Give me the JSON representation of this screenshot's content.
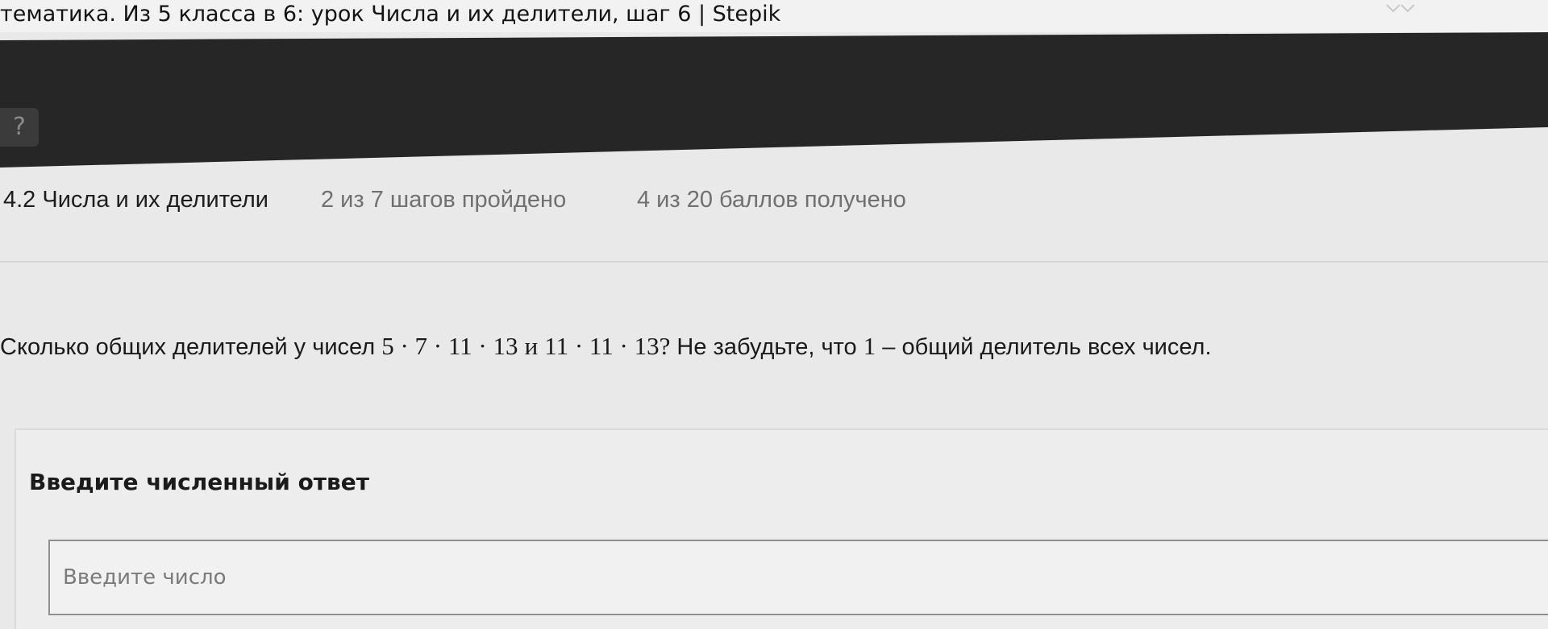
{
  "window": {
    "title": "тематика. Из 5 класса в 6: урок Числа и их делители, шаг 6 | Stepik"
  },
  "help": {
    "icon_glyph": "?"
  },
  "lesson": {
    "title": "4.2 Числа и их делители",
    "steps_progress": "2 из 7 шагов пройдено",
    "points_progress": "4 из 20 баллов  получено"
  },
  "question": {
    "prefix": "Сколько общих делителей у чисел",
    "expr1": "5 · 7 · 11 · 13",
    "conj": "и",
    "expr2": "11 · 11 · 13",
    "qmark": "?",
    "middle": "Не забудьте, что",
    "one": "1",
    "suffix": "– общий делитель всех чисел."
  },
  "answer": {
    "label": "Введите численный ответ",
    "placeholder": "Введите число",
    "value": ""
  }
}
